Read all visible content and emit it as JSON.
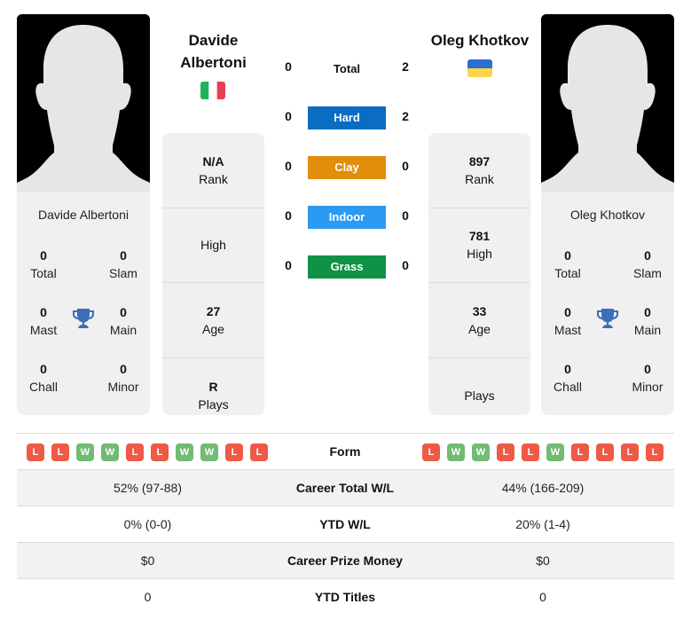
{
  "colors": {
    "hard": "#0a6cc2",
    "clay": "#e08e0b",
    "indoor": "#2b9af3",
    "grass": "#0f9245",
    "loss": "#ee5a45",
    "win": "#72bb72",
    "trophy": "#3a6fba"
  },
  "player1": {
    "name": "Davide Albertoni",
    "name_line1": "Davide",
    "name_line2": "Albertoni",
    "flag": "italy-flag",
    "card_name": "Davide Albertoni",
    "titles": {
      "total": {
        "value": "0",
        "label": "Total"
      },
      "slam": {
        "value": "0",
        "label": "Slam"
      },
      "mast": {
        "value": "0",
        "label": "Mast"
      },
      "main": {
        "value": "0",
        "label": "Main"
      },
      "chall": {
        "value": "0",
        "label": "Chall"
      },
      "minor": {
        "value": "0",
        "label": "Minor"
      }
    },
    "rank": {
      "value": "N/A",
      "label": "Rank"
    },
    "high": {
      "value": "",
      "label": "High"
    },
    "age": {
      "value": "27",
      "label": "Age"
    },
    "plays": {
      "value": "R",
      "label": "Plays"
    },
    "form": [
      "L",
      "L",
      "W",
      "W",
      "L",
      "L",
      "W",
      "W",
      "L",
      "L"
    ]
  },
  "player2": {
    "name": "Oleg Khotkov",
    "flag": "ukraine-flag",
    "card_name": "Oleg Khotkov",
    "titles": {
      "total": {
        "value": "0",
        "label": "Total"
      },
      "slam": {
        "value": "0",
        "label": "Slam"
      },
      "mast": {
        "value": "0",
        "label": "Mast"
      },
      "main": {
        "value": "0",
        "label": "Main"
      },
      "chall": {
        "value": "0",
        "label": "Chall"
      },
      "minor": {
        "value": "0",
        "label": "Minor"
      }
    },
    "rank": {
      "value": "897",
      "label": "Rank"
    },
    "high": {
      "value": "781",
      "label": "High"
    },
    "age": {
      "value": "33",
      "label": "Age"
    },
    "plays": {
      "value": "",
      "label": "Plays"
    },
    "form": [
      "L",
      "W",
      "W",
      "L",
      "L",
      "W",
      "L",
      "L",
      "L",
      "L"
    ]
  },
  "h2h": {
    "total": {
      "label": "Total",
      "p1": "0",
      "p2": "2"
    },
    "hard": {
      "label": "Hard",
      "p1": "0",
      "p2": "2"
    },
    "clay": {
      "label": "Clay",
      "p1": "0",
      "p2": "0"
    },
    "indoor": {
      "label": "Indoor",
      "p1": "0",
      "p2": "0"
    },
    "grass": {
      "label": "Grass",
      "p1": "0",
      "p2": "0"
    }
  },
  "table": {
    "form_label": "Form",
    "rows": [
      {
        "label": "Career Total W/L",
        "p1": "52% (97-88)",
        "p2": "44% (166-209)"
      },
      {
        "label": "YTD W/L",
        "p1": "0% (0-0)",
        "p2": "20% (1-4)"
      },
      {
        "label": "Career Prize Money",
        "p1": "$0",
        "p2": "$0"
      },
      {
        "label": "YTD Titles",
        "p1": "0",
        "p2": "0"
      }
    ]
  }
}
